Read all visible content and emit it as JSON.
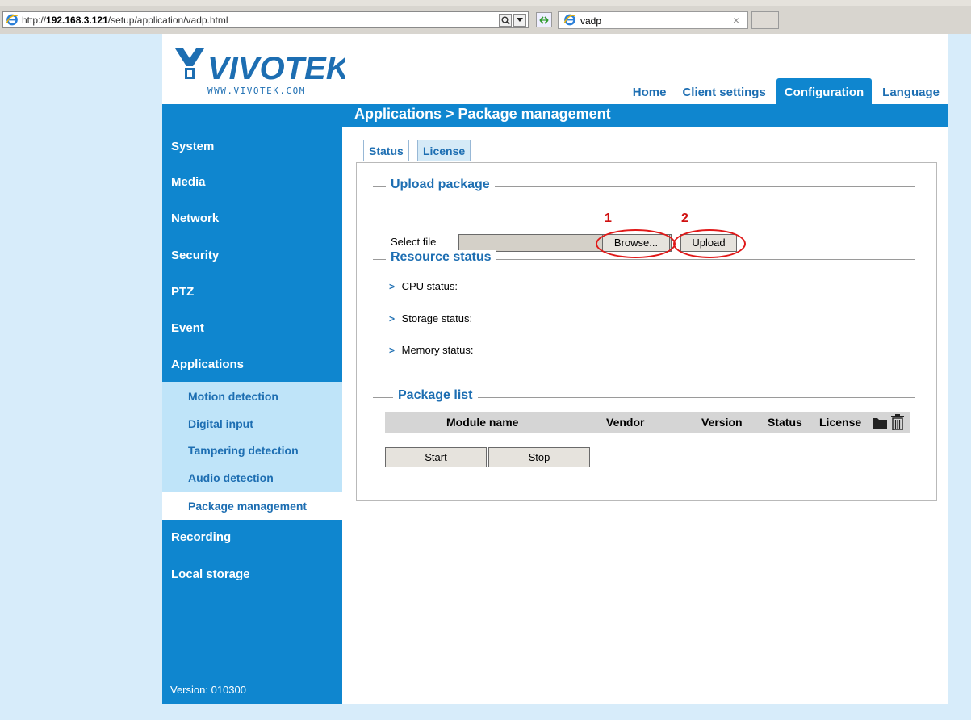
{
  "browser": {
    "url_prefix": "http://",
    "url_host": "192.168.3.121",
    "url_path": "/setup/application/vadp.html",
    "tab_title": "vadp",
    "search_icon": "search-icon",
    "dropdown_icon": "chevron-down-icon",
    "close_glyph": "×"
  },
  "brand": {
    "name": "VIVOTEK",
    "url": "WWW.VIVOTEK.COM"
  },
  "topnav": {
    "items": [
      "Home",
      "Client settings",
      "Configuration",
      "Language"
    ],
    "active": "Configuration"
  },
  "breadcrumb": "Applications  > Package management",
  "sidebar": {
    "items": [
      "System",
      "Media",
      "Network",
      "Security",
      "PTZ",
      "Event",
      "Applications",
      "Recording",
      "Local storage"
    ],
    "subitems": [
      "Motion detection",
      "Digital input",
      "Tampering detection",
      "Audio detection",
      "Package management"
    ],
    "active_subitem": "Package management",
    "version": "Version: 010300"
  },
  "tabs": [
    "Status",
    "License"
  ],
  "upload": {
    "legend": "Upload package",
    "select_label": "Select file",
    "browse_label": "Browse...",
    "upload_label": "Upload",
    "callout_1": "1",
    "callout_2": "2"
  },
  "resource": {
    "legend": "Resource status",
    "items": [
      "CPU status:",
      "Storage status:",
      "Memory status:"
    ]
  },
  "package_list": {
    "legend": "Package list",
    "columns": [
      "Module name",
      "Vendor",
      "Version",
      "Status",
      "License"
    ],
    "start_label": "Start",
    "stop_label": "Stop"
  },
  "colors": {
    "brand_blue": "#0f86cf",
    "callout_red": "#e01818"
  }
}
